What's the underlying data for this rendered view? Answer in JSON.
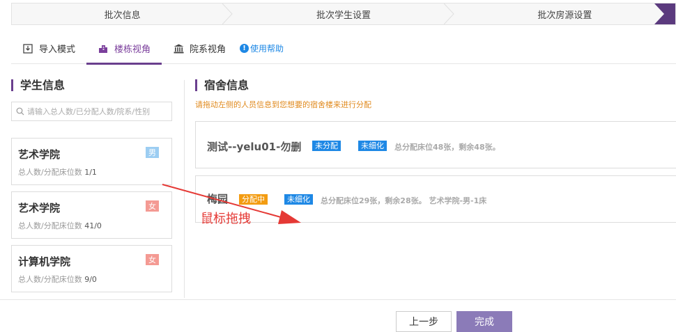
{
  "steps": [
    "批次信息",
    "批次学生设置",
    "批次房源设置"
  ],
  "tabs": [
    {
      "label": "导入模式",
      "icon": "import-icon",
      "active": false
    },
    {
      "label": "楼栋视角",
      "icon": "building-icon",
      "active": true
    },
    {
      "label": "院系视角",
      "icon": "institution-icon",
      "active": false
    }
  ],
  "help_label": "使用帮助",
  "student": {
    "title": "学生信息",
    "search_placeholder": "请输入总人数/已分配人数/院系/性别",
    "cards": [
      {
        "name": "艺术学院",
        "meta_label": "总人数/分配床位数",
        "meta_value": "1/1",
        "gender": "男"
      },
      {
        "name": "艺术学院",
        "meta_label": "总人数/分配床位数",
        "meta_value": "41/0",
        "gender": "女"
      },
      {
        "name": "计算机学院",
        "meta_label": "总人数/分配床位数",
        "meta_value": "9/0",
        "gender": "女"
      }
    ]
  },
  "dorm": {
    "title": "宿舍信息",
    "hint": "请拖动左侧的人员信息到您想要的宿舍楼来进行分配",
    "items": [
      {
        "name": "测试--yelu01-勿删",
        "status": "未分配",
        "refine": "未细化",
        "info": "总分配床位48张，剩余48张。"
      },
      {
        "name": "梅园",
        "status": "分配中",
        "refine": "未细化",
        "info": "总分配床位29张，剩余28张。 艺术学院-男-1床"
      }
    ]
  },
  "annotation": "鼠标拖拽",
  "buttons": {
    "prev": "上一步",
    "done": "完成"
  },
  "colors": {
    "accent": "#6a3f8e",
    "blue_tag": "#1e88e5",
    "orange_tag": "#f39c12",
    "hint": "#e08a1e",
    "annotation": "#e53935"
  }
}
